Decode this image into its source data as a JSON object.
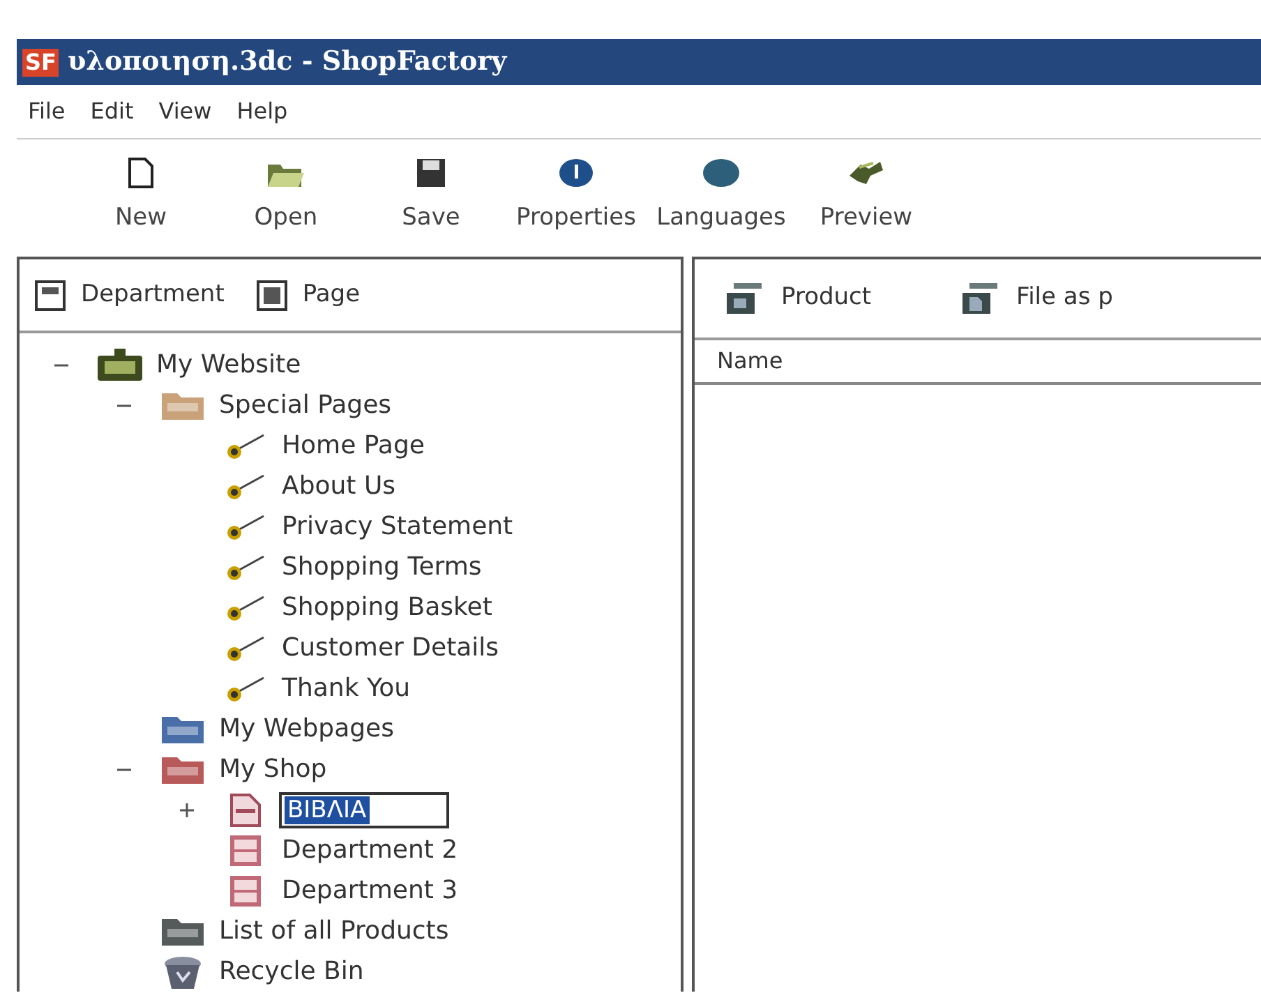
{
  "window": {
    "title": "υλοποιηση.3dc - ShopFactory",
    "app_badge": "SF"
  },
  "menu": [
    "File",
    "Edit",
    "View",
    "Help"
  ],
  "toolbar": [
    {
      "label": "New",
      "kind": "new"
    },
    {
      "label": "Open",
      "kind": "open"
    },
    {
      "label": "Save",
      "kind": "save"
    },
    {
      "label": "Properties",
      "kind": "properties"
    },
    {
      "label": "Languages",
      "kind": "languages"
    },
    {
      "label": "Preview",
      "kind": "preview"
    }
  ],
  "left_panel": {
    "buttons": [
      {
        "label": "Department",
        "kind": "department"
      },
      {
        "label": "Page",
        "kind": "page"
      }
    ],
    "tree": [
      {
        "label": "My Website",
        "kind": "website",
        "expanded": true,
        "children": [
          {
            "label": "Special Pages",
            "kind": "folder",
            "color": "#c9a27a",
            "expanded": true,
            "children": [
              {
                "label": "Home Page",
                "kind": "pin"
              },
              {
                "label": "About Us",
                "kind": "pin"
              },
              {
                "label": "Privacy Statement",
                "kind": "pin"
              },
              {
                "label": "Shopping Terms",
                "kind": "pin"
              },
              {
                "label": "Shopping Basket",
                "kind": "pin"
              },
              {
                "label": "Customer Details",
                "kind": "pin"
              },
              {
                "label": "Thank You",
                "kind": "pin"
              }
            ]
          },
          {
            "label": "My Webpages",
            "kind": "folder",
            "color": "#4a6ea8"
          },
          {
            "label": "My Shop",
            "kind": "folder",
            "color": "#b85a5a",
            "expanded": true,
            "children": [
              {
                "label": "ΒΙΒΛΙΑ",
                "kind": "page",
                "expanded": false,
                "editing": true
              },
              {
                "label": "Department 2",
                "kind": "department"
              },
              {
                "label": "Department 3",
                "kind": "department"
              }
            ]
          },
          {
            "label": "List of all Products",
            "kind": "folder",
            "color": "#555a5a"
          },
          {
            "label": "Recycle Bin",
            "kind": "recycle"
          }
        ]
      }
    ]
  },
  "right_panel": {
    "buttons": [
      {
        "label": "Product",
        "kind": "product"
      },
      {
        "label": "File as p",
        "kind": "file"
      }
    ],
    "table": {
      "columns": [
        "Name"
      ]
    }
  }
}
